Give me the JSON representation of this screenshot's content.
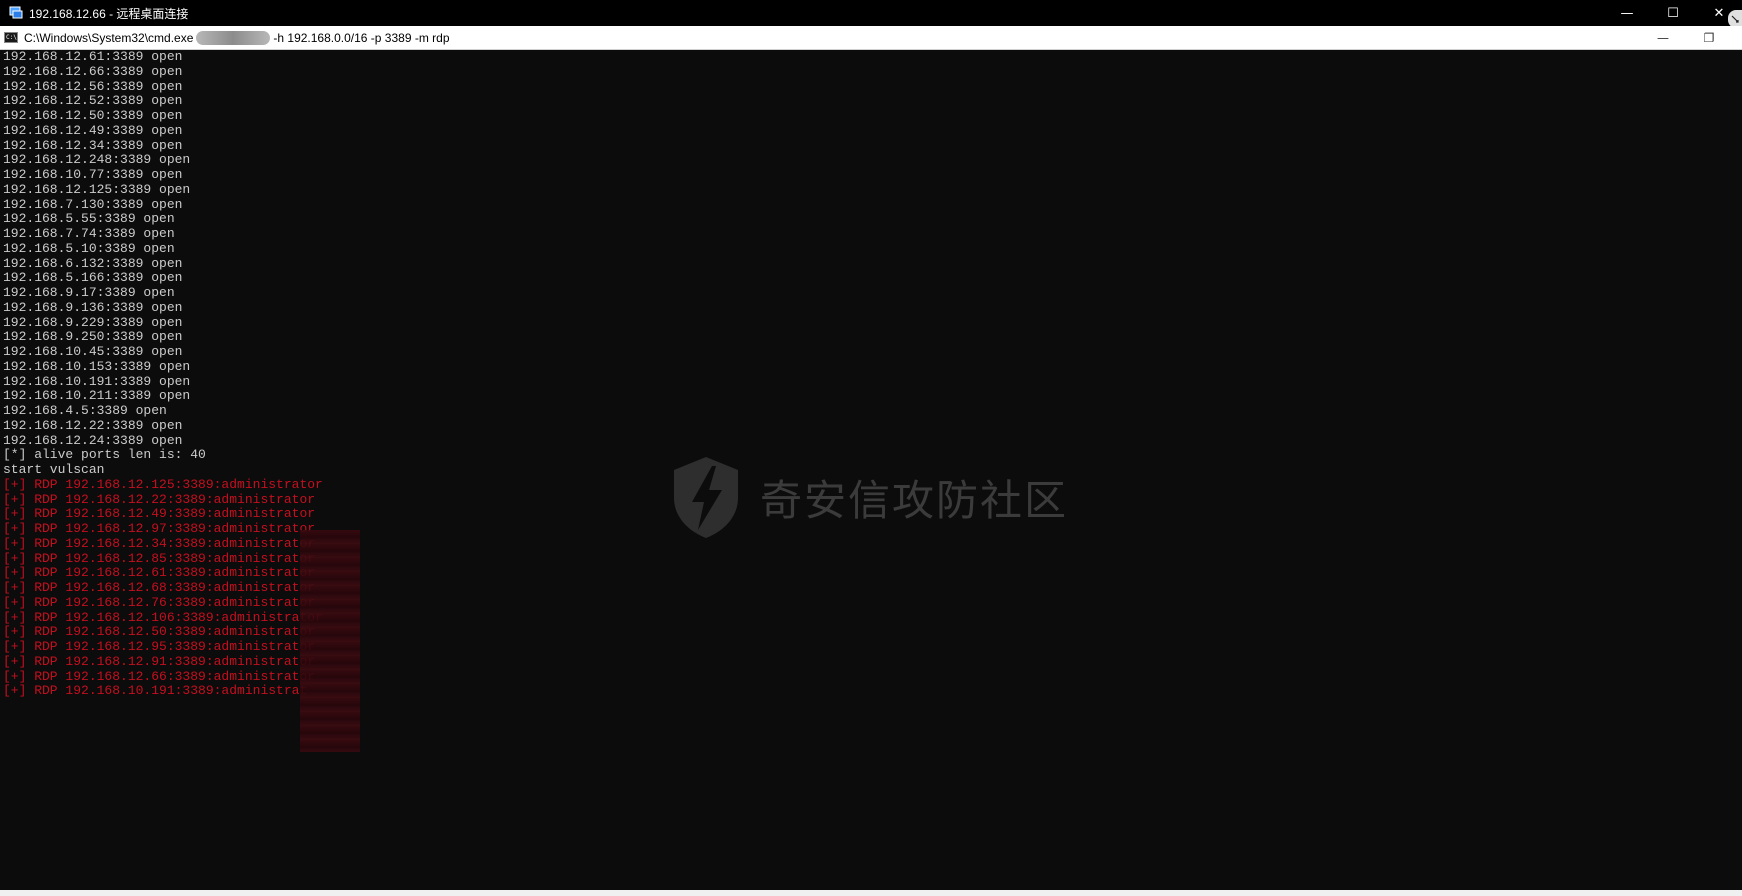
{
  "rdp_window": {
    "title": "192.168.12.66 - 远程桌面连接",
    "icon": "remote-desktop-icon",
    "controls": {
      "minimize": "—",
      "maximize": "☐",
      "close": "✕"
    }
  },
  "cmd_window": {
    "path": "C:\\Windows\\System32\\cmd.exe",
    "args": "-h 192.168.0.0/16 -p 3389 -m rdp",
    "icon": "cmd-icon",
    "icon_text": "C:\\",
    "controls": {
      "minimize": "—",
      "restore": "❐",
      "close": "✕"
    }
  },
  "console": {
    "lines": [
      "192.168.12.61:3389 open",
      "192.168.12.66:3389 open",
      "192.168.12.56:3389 open",
      "192.168.12.52:3389 open",
      "192.168.12.50:3389 open",
      "192.168.12.49:3389 open",
      "192.168.12.34:3389 open",
      "192.168.12.248:3389 open",
      "192.168.10.77:3389 open",
      "192.168.12.125:3389 open",
      "192.168.7.130:3389 open",
      "192.168.5.55:3389 open",
      "192.168.7.74:3389 open",
      "192.168.5.10:3389 open",
      "192.168.6.132:3389 open",
      "192.168.5.166:3389 open",
      "192.168.9.17:3389 open",
      "192.168.9.136:3389 open",
      "192.168.9.229:3389 open",
      "192.168.9.250:3389 open",
      "192.168.10.45:3389 open",
      "192.168.10.153:3389 open",
      "192.168.10.191:3389 open",
      "192.168.10.211:3389 open",
      "192.168.4.5:3389 open",
      "192.168.12.22:3389 open",
      "192.168.12.24:3389 open",
      "[*] alive ports len is: 40",
      "start vulscan"
    ],
    "results": [
      "[+] RDP 192.168.12.125:3389:administrator",
      "[+] RDP 192.168.12.22:3389:administrator",
      "[+] RDP 192.168.12.49:3389:administrator",
      "[+] RDP 192.168.12.97:3389:administrator",
      "[+] RDP 192.168.12.34:3389:administrator",
      "[+] RDP 192.168.12.85:3389:administrator",
      "[+] RDP 192.168.12.61:3389:administrator",
      "[+] RDP 192.168.12.68:3389:administrator",
      "[+] RDP 192.168.12.76:3389:administrator",
      "[+] RDP 192.168.12.106:3389:administrator",
      "[+] RDP 192.168.12.50:3389:administrator",
      "[+] RDP 192.168.12.95:3389:administrator",
      "[+] RDP 192.168.12.91:3389:administrator",
      "[+] RDP 192.168.12.66:3389:administrator",
      "[+] RDP 192.168.10.191:3389:administrat"
    ]
  },
  "watermark": {
    "text": "奇安信攻防社区",
    "icon": "lightning-shield-icon"
  },
  "colors": {
    "console_bg": "#0c0c0c",
    "console_text": "#cccccc",
    "result_red": "#c50f1f"
  }
}
